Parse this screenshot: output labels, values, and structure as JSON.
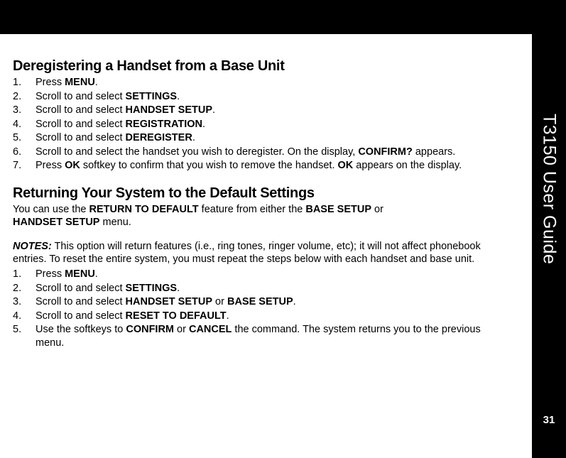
{
  "sidebar": {
    "title": "T3150 User Guide",
    "page_number": "31"
  },
  "section1": {
    "heading": "Deregistering a Handset from a Base Unit",
    "steps": [
      {
        "num": "1.",
        "pre": "Press ",
        "bold1": "MENU",
        "post1": "."
      },
      {
        "num": "2.",
        "pre": "Scroll to and select ",
        "bold1": "SETTINGS",
        "post1": "."
      },
      {
        "num": "3.",
        "pre": "Scroll to and select ",
        "bold1": "HANDSET SETUP",
        "post1": "."
      },
      {
        "num": "4.",
        "pre": "Scroll to and select ",
        "bold1": "REGISTRATION",
        "post1": "."
      },
      {
        "num": "5.",
        "pre": "Scroll to and select ",
        "bold1": "DEREGISTER",
        "post1": "."
      },
      {
        "num": "6.",
        "pre": "Scroll to and select the handset you wish to deregister. On the display, ",
        "bold1": "CONFIRM?",
        "post1": " appears."
      },
      {
        "num": "7.",
        "pre": "Press ",
        "bold1": "OK",
        "mid1": " softkey to confirm that you wish to remove the handset. ",
        "bold2": "OK",
        "post2": " appears on the display."
      }
    ]
  },
  "section2": {
    "heading": "Returning Your System to the Default Settings",
    "intro_pre": "You can use the ",
    "intro_bold1": "RETURN TO DEFAULT",
    "intro_mid1": " feature from either the ",
    "intro_bold2": "BASE SETUP",
    "intro_mid2": " or ",
    "intro_bold3": "HANDSET SETUP",
    "intro_post": " menu.",
    "notes_label": "NOTES:",
    "notes_text": " This option will return features (i.e., ring tones, ringer volume, etc); it will not affect phonebook entries. To reset the entire system, you must repeat the steps below with each handset and base unit.",
    "steps": [
      {
        "num": "1.",
        "pre": "Press ",
        "bold1": "MENU",
        "post1": "."
      },
      {
        "num": "2.",
        "pre": "Scroll to and select ",
        "bold1": "SETTINGS",
        "post1": "."
      },
      {
        "num": "3.",
        "pre": "Scroll to and select ",
        "bold1": "HANDSET SETUP",
        "mid1": " or ",
        "bold2": "BASE SETUP",
        "post2": "."
      },
      {
        "num": "4.",
        "pre": "Scroll to and select ",
        "bold1": "RESET TO DEFAULT",
        "post1": "."
      },
      {
        "num": "5.",
        "pre": "Use the softkeys to ",
        "bold1": "CONFIRM",
        "mid1": " or ",
        "bold2": "CANCEL",
        "post2": " the command. The system returns you to the previous menu."
      }
    ]
  }
}
